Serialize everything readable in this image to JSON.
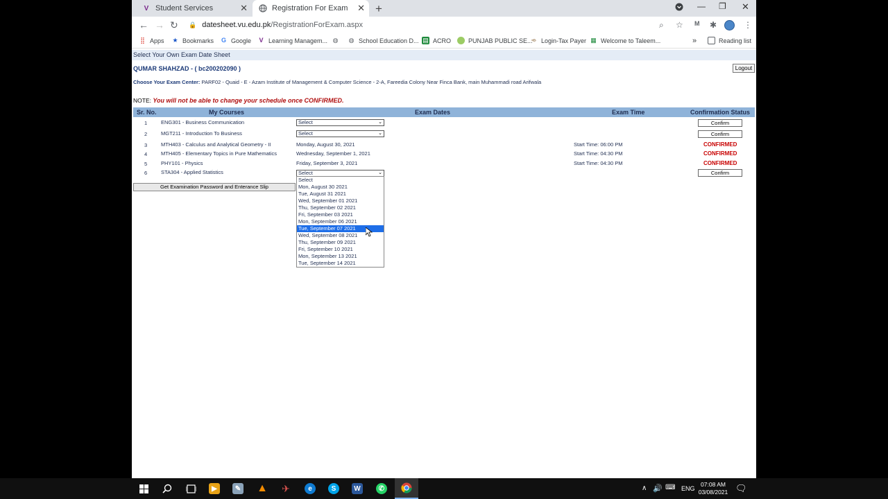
{
  "browser": {
    "tabs": [
      {
        "label": "Student Services"
      },
      {
        "label": "Registration For Exam"
      }
    ],
    "url_host": "datesheet.vu.edu.pk",
    "url_path": "/RegistrationForExam.aspx",
    "bookmarks": [
      {
        "label": "Apps"
      },
      {
        "label": "Bookmarks"
      },
      {
        "label": "Google"
      },
      {
        "label": "Learning Managem..."
      },
      {
        "label": "School Education D..."
      },
      {
        "label": "ACRO"
      },
      {
        "label": "PUNJAB PUBLIC SE..."
      },
      {
        "label": "Login-Tax Payer"
      },
      {
        "label": "Welcome to Taleem..."
      }
    ],
    "reading_list": "Reading list"
  },
  "page": {
    "header": "Select Your Own Exam Date Sheet",
    "student": "QUMAR SHAHZAD - ( bc200202090 )",
    "logout": "Logout",
    "center_label": "Choose Your Exam Center:",
    "center_value": "PARF02 - Quaid - E - Azam Institute of Management & Computer Science - 2-A, Fareedia Colony Near Finca Bank, main Muhammadi road Arifwala",
    "note_label": "NOTE:",
    "note_text": "You will not be able to change your schedule once CONFIRMED.",
    "columns": {
      "sr": "Sr. No.",
      "courses": "My Courses",
      "dates": "Exam Dates",
      "time": "Exam Time",
      "status": "Confirmation Status"
    },
    "rows": [
      {
        "sr": "1",
        "course": "ENG301 - Business Communication",
        "select": "Select",
        "button": "Confirm"
      },
      {
        "sr": "2",
        "course": "MGT211 - Introduction To Business",
        "select": "Select",
        "button": "Confirm"
      },
      {
        "sr": "3",
        "course": "MTH403 - Calculus and Analytical Geometry - II",
        "date": "Monday, August 30, 2021",
        "time": "Start Time: 06:00 PM",
        "status": "CONFIRMED"
      },
      {
        "sr": "4",
        "course": "MTH405 - Elementary Topics in Pure Mathematics",
        "date": "Wednesday, September 1, 2021",
        "time": "Start Time: 04:30 PM",
        "status": "CONFIRMED"
      },
      {
        "sr": "5",
        "course": "PHY101 - Physics",
        "date": "Friday, September 3, 2021",
        "time": "Start Time: 04:30 PM",
        "status": "CONFIRMED"
      },
      {
        "sr": "6",
        "course": "STA304 - Applied Statistics",
        "select": "Select",
        "button": "Confirm"
      }
    ],
    "slip_button": "Get Examination Password and Enterance Slip",
    "dropdown_options": [
      "Select",
      "Mon, August 30 2021",
      "Tue, August 31 2021",
      "Wed, September 01 2021",
      "Thu, September 02 2021",
      "Fri, September 03 2021",
      "Mon, September 06 2021",
      "Tue, September 07 2021",
      "Wed, September 08 2021",
      "Thu, September 09 2021",
      "Fri, September 10 2021",
      "Mon, September 13 2021",
      "Tue, September 14 2021"
    ],
    "dropdown_highlighted": "Tue, September 07 2021"
  },
  "taskbar": {
    "lang": "ENG",
    "time": "07:08 AM",
    "date": "03/08/2021"
  }
}
